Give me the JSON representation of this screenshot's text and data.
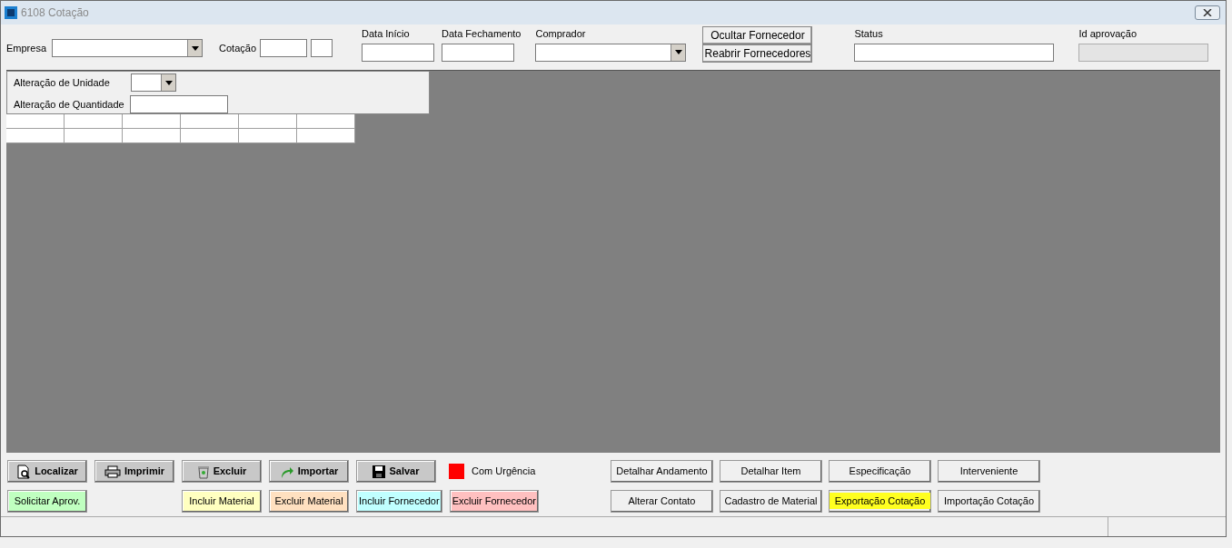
{
  "window": {
    "title": "6108 Cotação"
  },
  "header": {
    "empresa_label": "Empresa",
    "cotacao_label": "Cotação",
    "data_inicio_label": "Data Início",
    "data_fechamento_label": "Data Fechamento",
    "comprador_label": "Comprador",
    "status_label": "Status",
    "id_aprovacao_label": "Id aprovação",
    "id_aprovacao_disabled": true,
    "buttons": [
      "Ocultar Fornecedor",
      "Reabrir Fornecedores"
    ]
  },
  "panel": {
    "unidade_label": "Alteração de Unidade",
    "quantidade_label": "Alteração de Quantidade"
  },
  "left_buttons": [
    {
      "label": "Localizar",
      "kind": "search"
    },
    {
      "label": "Imprimir",
      "kind": "print"
    },
    {
      "label": "Excluir",
      "kind": "delete"
    },
    {
      "label": "Importar",
      "kind": "import"
    },
    {
      "label": "Salvar",
      "kind": "save"
    }
  ],
  "urgency": {
    "label": "Com Urgência",
    "color": "#ff0000"
  },
  "colored_buttons": [
    {
      "label": "Solicitar Aprov.",
      "color": "#c0ffc0"
    },
    {
      "label": "Incluir Material",
      "color": "#ffffc0"
    },
    {
      "label": "Excluir Material",
      "color": "#ffe0c0"
    },
    {
      "label": "Incluir Fornecedor",
      "color": "#c0ffff"
    },
    {
      "label": "Excluir Fornecedor",
      "color": "#ffc0c0"
    }
  ],
  "right_buttons": [
    {
      "label": "Detalhar Andamento",
      "highlighted": false
    },
    {
      "label": "Detalhar Item",
      "highlighted": false
    },
    {
      "label": "Especificação",
      "highlighted": false
    },
    {
      "label": "Interveniente",
      "highlighted": false
    },
    {
      "label": "Alterar Contato",
      "highlighted": false
    },
    {
      "label": "Cadastro de Material",
      "highlighted": false
    },
    {
      "label": "Exportação Cotação",
      "highlighted": true
    },
    {
      "label": "Importação Cotação",
      "highlighted": false
    }
  ]
}
